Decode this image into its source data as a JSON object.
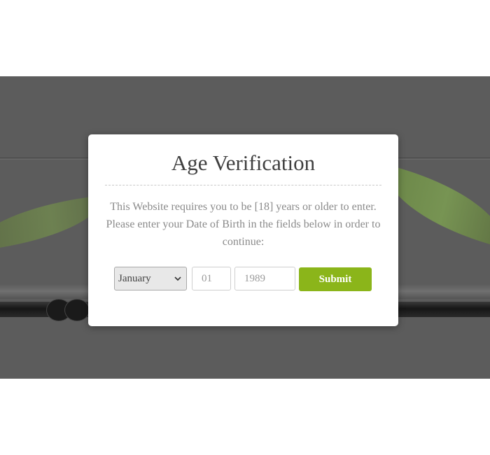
{
  "modal": {
    "title": "Age Verification",
    "message": "This Website requires you to be [18] years or older to enter. Please enter your Date of Birth in the fields below in order to continue:",
    "month_value": "January",
    "day_placeholder": "01",
    "year_placeholder": "1989",
    "submit_label": "Submit"
  },
  "colors": {
    "backdrop": "#5c5c5c",
    "submit": "#8bb51a",
    "title_text": "#3f3f3f",
    "message_text": "#8a8a8a"
  },
  "icons": {
    "select_arrow": "chevron-down-icon"
  }
}
